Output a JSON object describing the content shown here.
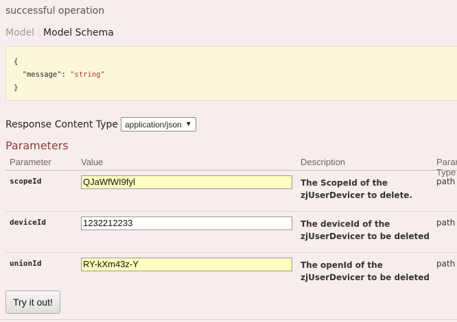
{
  "response": {
    "cut_heading": "",
    "message": "successful operation",
    "tabs": [
      "Model",
      "Model Schema"
    ],
    "schema_lines": [
      "{",
      "  \"message\": \"string\"",
      "}"
    ]
  },
  "content_type": {
    "label": "Response Content Type",
    "selected": "application/json",
    "caret": "▼"
  },
  "parameters": {
    "heading": "Parameters",
    "columns": [
      "Parameter",
      "Value",
      "Description",
      "Parameter Type"
    ],
    "rows": [
      {
        "name": "scopeId",
        "value": "QJaWfWI9fyl",
        "description": "The ScopeId of the zjUserDevicer to delete.",
        "type": "path"
      },
      {
        "name": "deviceId",
        "value": "1232212233",
        "description": "The deviceId of the zjUserDevicer to be deleted",
        "type": "path"
      },
      {
        "name": "unionId",
        "value": "RY-kXm43z-Y",
        "description": "The openId of the zjUserDevicer to be deleted",
        "type": "path"
      }
    ]
  },
  "actions": {
    "try_label": "Try it out!"
  }
}
